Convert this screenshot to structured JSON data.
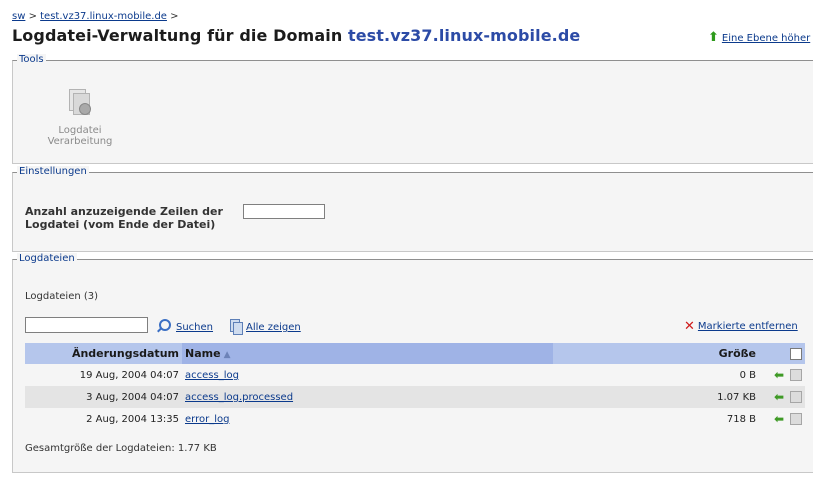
{
  "breadcrumb": {
    "root": "sw",
    "sep1": " > ",
    "domain": "test.vz37.linux-mobile.de",
    "sep2": " >"
  },
  "header": {
    "title_prefix": "Logdatei-Verwaltung für die Domain ",
    "title_domain": "test.vz37.linux-mobile.de",
    "up_link": "Eine Ebene höher"
  },
  "tools": {
    "legend": "Tools",
    "items": [
      {
        "label": "Logdatei Verarbeitung",
        "icon": "log-processing-icon",
        "enabled": false
      }
    ]
  },
  "settings": {
    "legend": "Einstellungen",
    "lines_label_1": "Anzahl anzuzeigende Zeilen der",
    "lines_label_2": "Logdatei (vom Ende der Datei)",
    "lines_value": ""
  },
  "logfiles": {
    "legend": "Logdateien",
    "count_label": "Logdateien (3)",
    "search_value": "",
    "search_label": "Suchen",
    "show_all_label": "Alle zeigen",
    "remove_label": "Markierte entfernen",
    "columns": {
      "date": "Änderungsdatum",
      "name": "Name",
      "size": "Größe"
    },
    "sort_indicator": "▲",
    "rows": [
      {
        "date": "19 Aug, 2004 04:07",
        "name": "access_log",
        "size": "0 B"
      },
      {
        "date": "3 Aug, 2004 04:07",
        "name": "access_log.processed",
        "size": "1.07 KB"
      },
      {
        "date": "2 Aug, 2004 13:35",
        "name": "error_log",
        "size": "718 B"
      }
    ],
    "total": "Gesamtgröße der Logdateien: 1.77 KB"
  },
  "colors": {
    "accent": "#0b3a8c",
    "header_blue": "#b5c6ec",
    "sorted_column": "#9fb3e6",
    "download_green": "#3f9a26",
    "remove_red": "#cf1b1b"
  }
}
